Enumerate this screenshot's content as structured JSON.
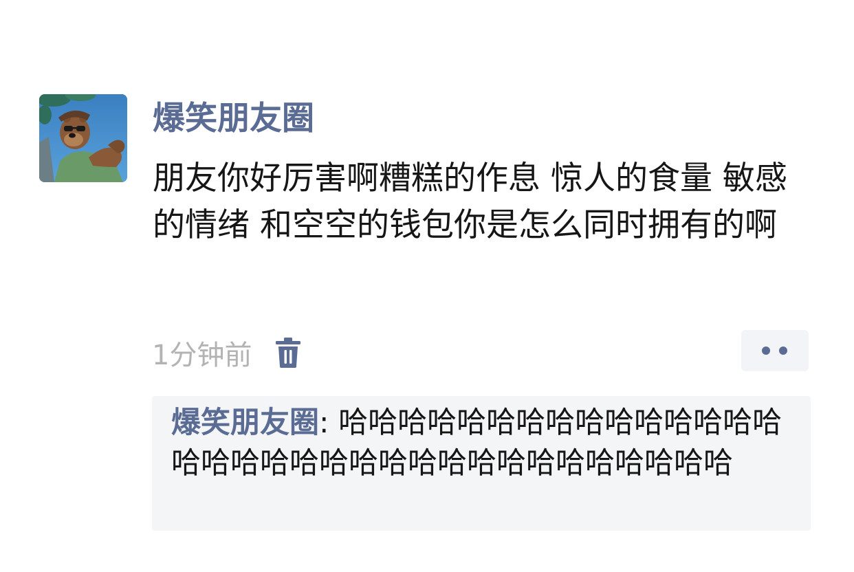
{
  "post": {
    "author": "爆笑朋友圈",
    "text": "朋友你好厉害啊糟糕的作息 惊人的食量 敏感的情绪 和空空的钱包你是怎么同时拥有的啊",
    "timestamp": "1分钟前"
  },
  "icons": {
    "avatar": "cartoon-bear-avatar",
    "delete": "trash-icon",
    "more": "more-dots-icon"
  },
  "comments": [
    {
      "author": "爆笑朋友圈",
      "separator": ": ",
      "text": "哈哈哈哈哈哈哈哈哈哈哈哈哈哈哈哈哈哈哈哈哈哈哈哈哈哈哈哈哈哈哈哈哈哈"
    }
  ],
  "colors": {
    "author_name": "#5a6b94",
    "body_text": "#161616",
    "timestamp": "#b3b3b3",
    "comment_bg": "#f4f5f7",
    "avatar_sky": "#3f86c6"
  }
}
